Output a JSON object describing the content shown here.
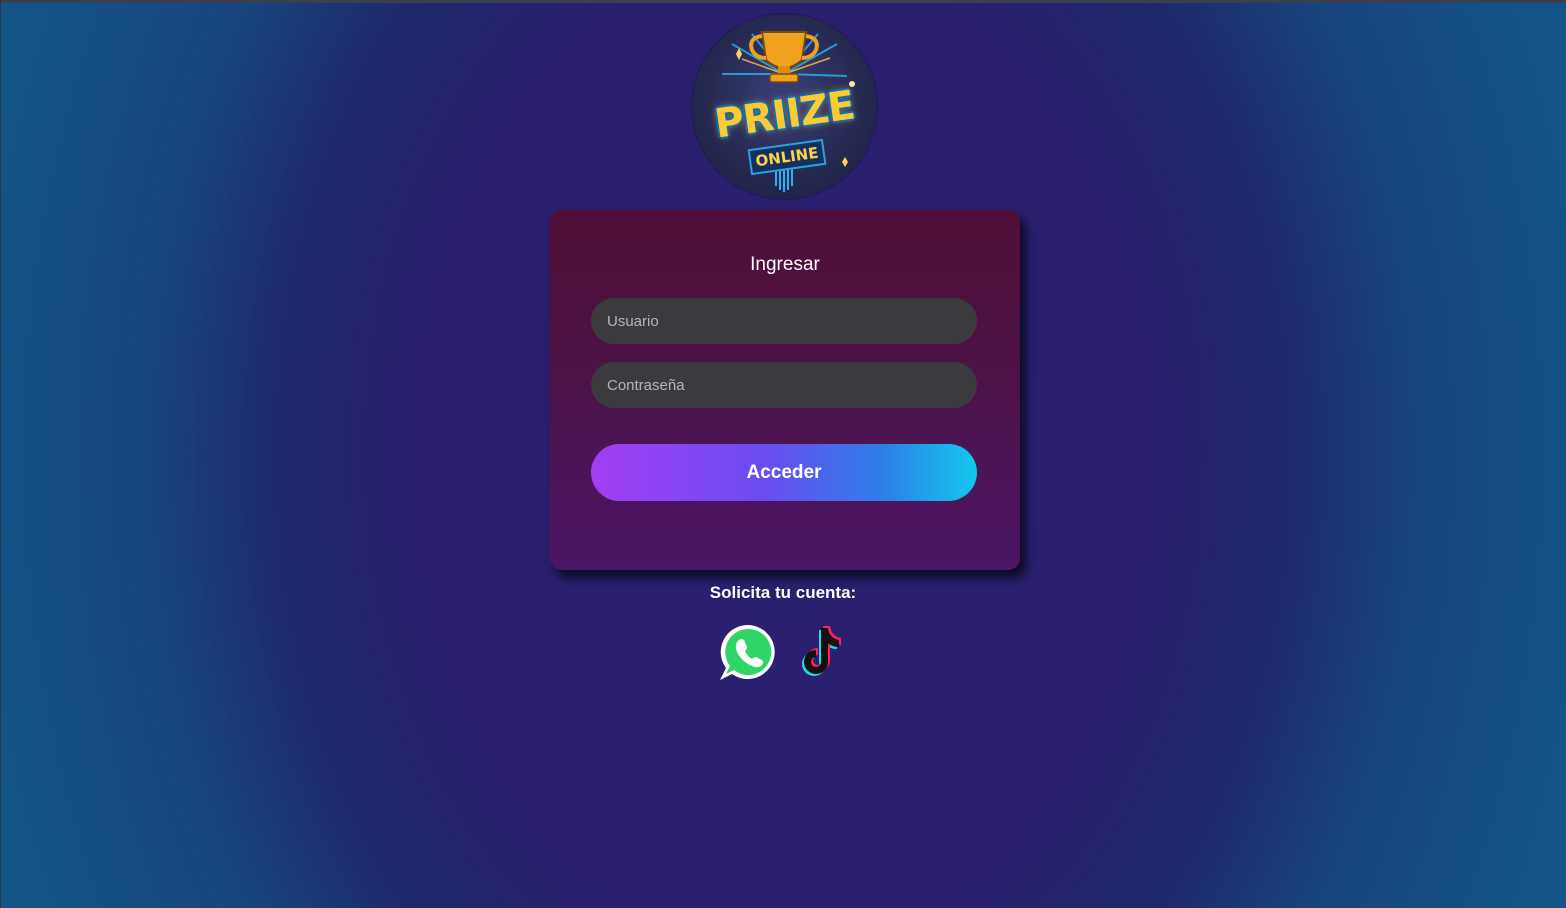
{
  "logo": {
    "brand_main": "PRIIZE",
    "brand_sub": "ONLINE"
  },
  "login": {
    "title": "Ingresar",
    "username_placeholder": "Usuario",
    "username_value": "",
    "password_placeholder": "Contraseña",
    "password_value": "",
    "submit_label": "Acceder"
  },
  "request": {
    "label": "Solicita tu cuenta:"
  },
  "social": [
    {
      "name": "WhatsApp",
      "icon": "whatsapp-icon"
    },
    {
      "name": "TikTok",
      "icon": "tiktok-icon"
    }
  ],
  "colors": {
    "button_gradient_start": "#a33ef5",
    "button_gradient_end": "#12c8ec",
    "card_top": "#4f0e35",
    "card_bottom": "#4c1566",
    "field_bg": "#3b3a3f"
  }
}
